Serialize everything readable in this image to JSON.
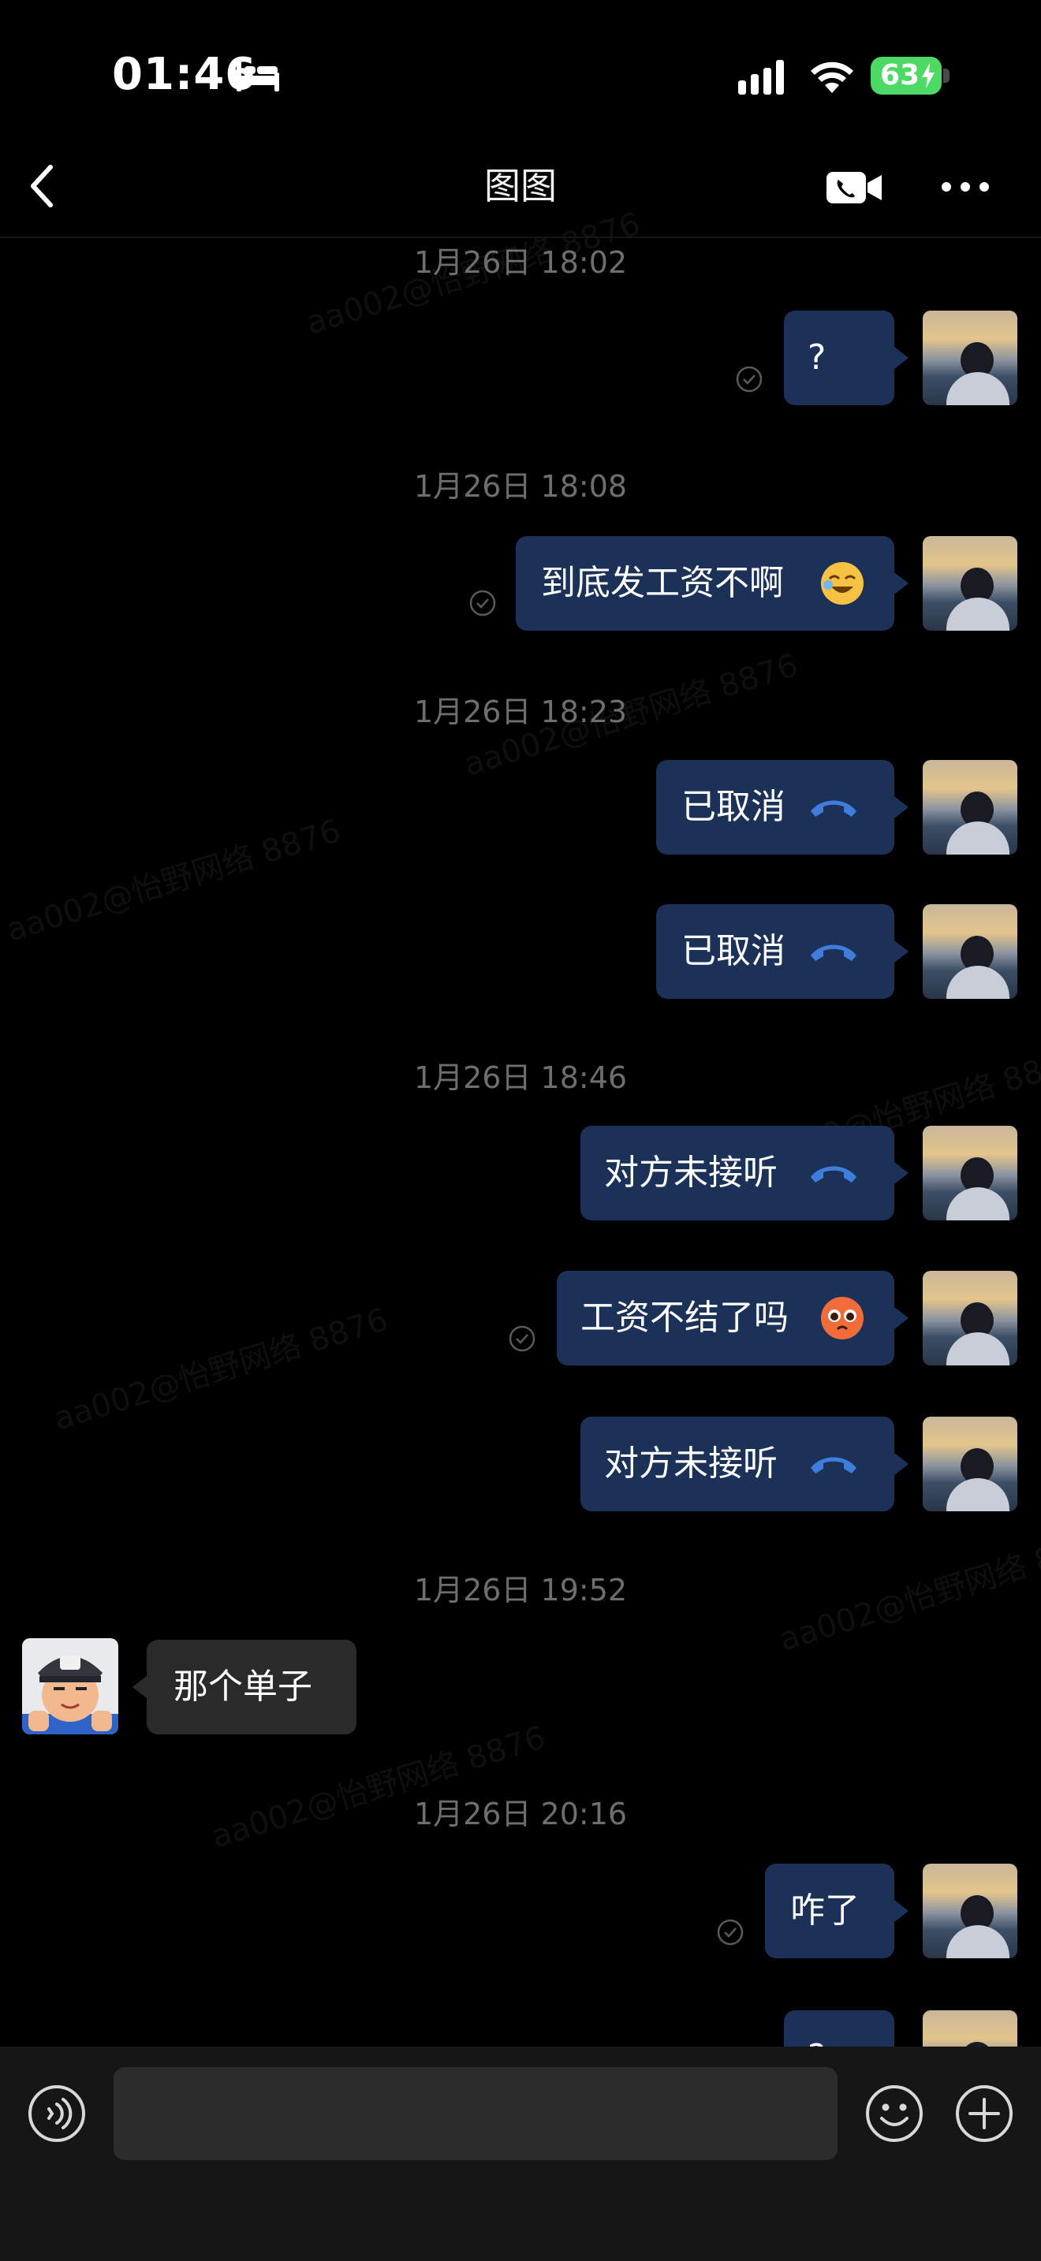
{
  "status_bar": {
    "time": "01:46",
    "battery": "63"
  },
  "header": {
    "title": "图图"
  },
  "watermark": "aa002@怡野网络 8876",
  "messages": {
    "ts1": "1月26日 18:02",
    "m1": "?",
    "ts2": "1月26日 18:08",
    "m2": "到底发工资不啊",
    "ts3": "1月26日 18:23",
    "m3": "已取消",
    "m4": "已取消",
    "ts4": "1月26日 18:46",
    "m5": "对方未接听",
    "m6": "工资不结了吗",
    "m7": "对方未接听",
    "ts5": "1月26日 19:52",
    "m8": "那个单子",
    "ts6": "1月26日 20:16",
    "m9": "咋了",
    "m10": "?"
  },
  "input": {
    "placeholder": ""
  },
  "colors": {
    "bubble_out": "#1b3158",
    "bubble_in": "#2a2a2a",
    "call_icon": "#3f7ddc"
  }
}
